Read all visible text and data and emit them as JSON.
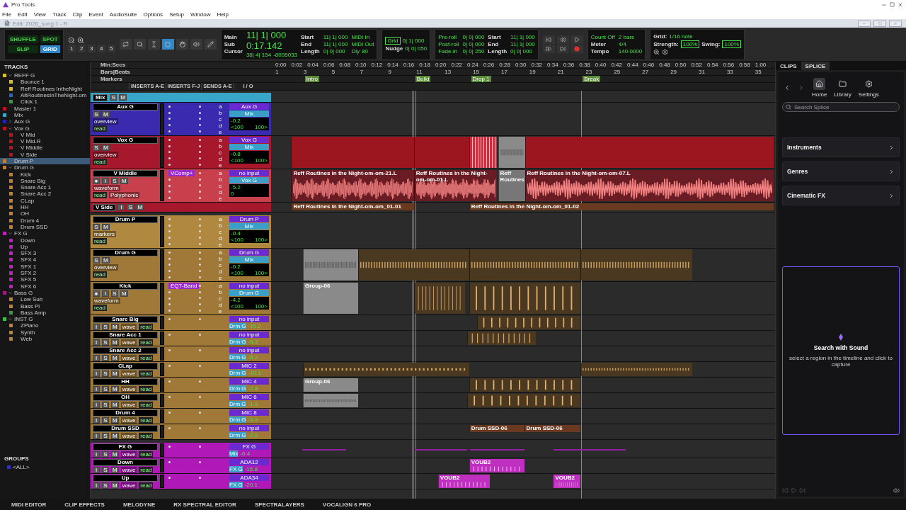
{
  "window": {
    "title": "Pro Tools"
  },
  "menu": [
    "File",
    "Edit",
    "View",
    "Track",
    "Clip",
    "Event",
    "AudioSuite",
    "Options",
    "Setup",
    "Window",
    "Help"
  ],
  "document": {
    "title": "Edit: 2026_song 1 - R"
  },
  "toolbar": {
    "edit_modes": [
      {
        "label": "SHUFFLE",
        "selected": false
      },
      {
        "label": "SPOT",
        "selected": false
      },
      {
        "label": "SLIP",
        "selected": false
      },
      {
        "label": "GRID",
        "selected": true
      }
    ],
    "zoom_presets": [
      "1",
      "2",
      "3",
      "4",
      "5"
    ],
    "counter": {
      "main_label": "Main",
      "main": "11| 1| 000",
      "sub_label": "Sub",
      "sub": "0:17.142",
      "cursor_label": "Cursor",
      "cursor": "38| 4| 154",
      "samples": "-8095033"
    },
    "selection": [
      {
        "label": "Start",
        "value": "11| 1| 000"
      },
      {
        "label": "End",
        "value": "11| 1| 000"
      },
      {
        "label": "Length",
        "value": "0| 0| 000"
      }
    ],
    "midi": [
      "MIDI In",
      "MIDI Out"
    ],
    "dly": "Dly",
    "velocity": "80",
    "grid": {
      "label": "Grid",
      "value": "0| 1| 000"
    },
    "nudge": {
      "label": "Nudge",
      "value": "0| 0| 050"
    },
    "preroll": [
      {
        "label": "Pre-roll",
        "value": "0| 0| 000"
      },
      {
        "label": "Post-roll",
        "value": "0| 0| 000"
      },
      {
        "label": "Fade-in",
        "value": "0| 0| 250"
      }
    ],
    "selection2": [
      {
        "label": "Start",
        "value": "11| 1| 000"
      },
      {
        "label": "End",
        "value": "11| 1| 000"
      },
      {
        "label": "Length",
        "value": "0| 0| 000"
      }
    ],
    "tempo": {
      "count_off": "Count Off",
      "count_value": "2 bars",
      "meter_label": "Meter",
      "meter": "4/4",
      "tempo_label": "Tempo",
      "tempo": "140.0000"
    },
    "quantize": {
      "grid_label": "Grid:",
      "grid": "1/16 note",
      "strength_label": "Strength:",
      "strength": "100%",
      "swing_label": "Swing:",
      "swing": "100%"
    }
  },
  "tracks_panel": {
    "title": "TRACKS",
    "items": [
      {
        "name": "REFF G",
        "color": "#d8c020",
        "expanded": true,
        "selected": false,
        "children": [
          {
            "name": "Bounce 1",
            "color": "#d8c020",
            "selected": false
          },
          {
            "name": "Reff Routines IntheNight",
            "color": "#d8c020",
            "selected": false
          },
          {
            "name": "AltRoutinesInTheNight.om",
            "color": "#3060d0",
            "selected": false
          },
          {
            "name": "Click 1",
            "color": "#30a040",
            "selected": false
          }
        ]
      },
      {
        "name": "Master 1",
        "color": "#c01020",
        "selected": false
      },
      {
        "name": "Mix",
        "color": "#37a6c8",
        "selected": false
      },
      {
        "name": "Aux G",
        "color": "#2020c0",
        "expanded": false,
        "selected": false
      },
      {
        "name": "Vox G",
        "color": "#c01020",
        "expanded": true,
        "selected": false,
        "children": [
          {
            "name": "V Mid",
            "color": "#c01020",
            "selected": false
          },
          {
            "name": "V Mid.R",
            "color": "#c01020",
            "selected": false
          },
          {
            "name": "V Middle",
            "color": "#c01020",
            "selected": false
          },
          {
            "name": "V Side",
            "color": "#c01020",
            "selected": false
          }
        ]
      },
      {
        "name": "Drum P",
        "color": "#c08030",
        "selected": true
      },
      {
        "name": "Drum G",
        "color": "#c08030",
        "expanded": true,
        "selected": false,
        "children": [
          {
            "name": "Kick",
            "color": "#c08030",
            "selected": false
          },
          {
            "name": "Snare Big",
            "color": "#c08030",
            "selected": false
          },
          {
            "name": "Snare Acc 1",
            "color": "#c08030",
            "selected": false
          },
          {
            "name": "Snare Acc 2",
            "color": "#c08030",
            "selected": false
          },
          {
            "name": "CLap",
            "color": "#c08030",
            "selected": false
          },
          {
            "name": "HH",
            "color": "#c08030",
            "selected": false
          },
          {
            "name": "OH",
            "color": "#c08030",
            "selected": false
          },
          {
            "name": "Drum 4",
            "color": "#c08030",
            "selected": false
          },
          {
            "name": "Drum SSD",
            "color": "#c08030",
            "selected": false
          }
        ]
      },
      {
        "name": "FX G",
        "color": "#c020c0",
        "expanded": true,
        "selected": false,
        "children": [
          {
            "name": "Down",
            "color": "#c020c0",
            "selected": false
          },
          {
            "name": "Up",
            "color": "#c020c0",
            "selected": false
          },
          {
            "name": "SFX 3",
            "color": "#c020c0",
            "selected": false
          },
          {
            "name": "SFX 4",
            "color": "#c020c0",
            "selected": false
          },
          {
            "name": "SFX 1",
            "color": "#c020c0",
            "selected": false
          },
          {
            "name": "SFX 2",
            "color": "#c020c0",
            "selected": false
          },
          {
            "name": "SFX 5",
            "color": "#c020c0",
            "selected": false
          },
          {
            "name": "SFX 6",
            "color": "#c020c0",
            "selected": false
          }
        ]
      },
      {
        "name": "Bass G",
        "color": "#a01880",
        "expanded": true,
        "selected": false,
        "children": [
          {
            "name": "Low Sub",
            "color": "#c08030",
            "selected": false
          },
          {
            "name": "Bass Pl",
            "color": "#c08030",
            "selected": false
          },
          {
            "name": "Bass Amp",
            "color": "#30a040",
            "selected": false
          }
        ]
      },
      {
        "name": "INST G",
        "color": "#40c040",
        "expanded": true,
        "selected": false,
        "children": [
          {
            "name": "ZPiano",
            "color": "#c08030",
            "selected": false
          },
          {
            "name": "Synth",
            "color": "#c08030",
            "selected": false
          },
          {
            "name": "Web",
            "color": "#c08030",
            "selected": false
          }
        ]
      }
    ]
  },
  "groups_panel": {
    "title": "GROUPS",
    "items": [
      {
        "name": "<ALL>",
        "color": "#3030c0"
      }
    ]
  },
  "rulers": [
    {
      "label": "Min:Secs",
      "ticks": [
        "0:00",
        "0:02",
        "0:04",
        "0:06",
        "0:08",
        "0:10",
        "0:12",
        "0:14",
        "0:16",
        "0:18",
        "0:20",
        "0:22",
        "0:24",
        "0:26",
        "0:28",
        "0:30",
        "0:32",
        "0:34",
        "0:36",
        "0:38",
        "0:40",
        "0:42",
        "0:44",
        "0:46",
        "0:48",
        "0:50",
        "0:52",
        "0:54",
        "0:56",
        "0:58",
        "1:00"
      ]
    },
    {
      "label": "Bars|Beats",
      "ticks": [
        "1",
        "3",
        "5",
        "7",
        "9",
        "11",
        "13",
        "15",
        "17",
        "19",
        "21",
        "23",
        "25",
        "27",
        "29",
        "31",
        "33",
        "35"
      ]
    },
    {
      "label": "Markers",
      "markers": [
        "Intro",
        "Build",
        "Drop 1",
        "Break"
      ]
    }
  ],
  "columns": [
    "INSERTS A-E",
    "INSERTS F-J",
    "SENDS A-E",
    "I / O"
  ],
  "tracks": [
    {
      "kind": "thin",
      "name": "Mix",
      "color": "#37a6c8",
      "buttons": [
        "S",
        "M"
      ]
    },
    {
      "kind": "large",
      "name": "Aux G",
      "color": "#3a2ab0",
      "buttons": [
        "S",
        "M"
      ],
      "view": "overview",
      "automation": "read",
      "sends": [
        "a",
        "b",
        "c",
        "d",
        "e"
      ],
      "input": "Aux G",
      "output": "Mix",
      "volume": "-0.2",
      "pan": [
        "<100",
        "100>"
      ]
    },
    {
      "kind": "large",
      "name": "Vox G",
      "color": "#a8182c",
      "buttons": [
        "S",
        "M"
      ],
      "view": "overview",
      "automation": "read",
      "sends": [
        "a",
        "b",
        "c",
        "d",
        "e"
      ],
      "input": "Vox G",
      "output": "Mix",
      "volume": "-0.8",
      "pan": [
        "<100",
        "100>"
      ],
      "clips": [
        {
          "kind": "block"
        },
        {
          "kind": "block"
        },
        {
          "kind": "striped"
        },
        {
          "kind": "grey"
        },
        {
          "kind": "block"
        }
      ]
    },
    {
      "kind": "large",
      "name": "V Middle",
      "color": "#c8404c",
      "buttons": [
        "●",
        "I",
        "S",
        "M"
      ],
      "view": "waveform",
      "automation": "read",
      "extra": "Polyphonic",
      "inserts": [
        "VComp+"
      ],
      "sends": [
        "a",
        "b",
        "c",
        "d",
        "e"
      ],
      "input": "no input",
      "output": "Vox G",
      "volume": "-5.2",
      "pan": [
        "0"
      ],
      "clips": [
        {
          "kind": "waveform",
          "label": "Reff Routines in the Night-om-om-21.L"
        },
        {
          "kind": "waveform",
          "label": "Reff Routines in the Night-om-om-01.L"
        },
        {
          "kind": "grey-wave",
          "label": "Reff Routines"
        },
        {
          "kind": "waveform",
          "label": "Reff Routines in the Night-om-om-07.L"
        }
      ]
    },
    {
      "kind": "thin",
      "name": "V Side",
      "color": "#a8182c",
      "buttons": [
        "I",
        "S",
        "M"
      ],
      "clips": [
        {
          "kind": "bar",
          "label": "Reff Routines in the Night-om-om_01-01"
        },
        {
          "kind": "bar",
          "label": "Reff Routines in the Night-om-om_01-02"
        }
      ]
    },
    {
      "kind": "large",
      "name": "Drum P",
      "color": "#b08840",
      "buttons": [
        "S",
        "M"
      ],
      "view": "markers",
      "automation": "read",
      "sends": [
        "a",
        "b",
        "c",
        "d",
        "e"
      ],
      "input": "Drum P",
      "output": "Mix",
      "volume": "-0.4",
      "pan": [
        "<100",
        "100>"
      ]
    },
    {
      "kind": "large",
      "name": "Drum G",
      "color": "#a07838",
      "buttons": [
        "S",
        "M"
      ],
      "view": "overview",
      "automation": "read",
      "sends": [
        "a",
        "b",
        "c",
        "d",
        "e"
      ],
      "input": "Drum G",
      "output": "Mix",
      "volume": "-0.2",
      "pan": [
        "<100",
        "100>"
      ],
      "clips": [
        {
          "kind": "grey"
        },
        {
          "kind": "strip"
        },
        {
          "kind": "strip"
        },
        {
          "kind": "strip"
        }
      ]
    },
    {
      "kind": "large",
      "name": "Kick",
      "color": "#a07838",
      "buttons": [
        "●",
        "I",
        "S",
        "M"
      ],
      "view": "waveform",
      "automation": "read",
      "inserts": [
        "EQ7-Band"
      ],
      "sends": [
        "a",
        "b",
        "c",
        "d",
        "e"
      ],
      "input": "no input",
      "output": "Drum G",
      "volume": "-4.2",
      "pan": [
        "<100",
        "100>"
      ],
      "clips": [
        {
          "kind": "grey",
          "label": "Group-06"
        },
        {
          "kind": "hits"
        },
        {
          "kind": "hits"
        }
      ]
    },
    {
      "kind": "small",
      "name": "Snare Big",
      "color": "#a07838",
      "buttons": [
        "I",
        "S",
        "M"
      ],
      "view": "wave",
      "automation": "read",
      "input": "no input",
      "output": "Drm G",
      "volume": "-15.2",
      "clips": [
        {
          "kind": "hits"
        }
      ]
    },
    {
      "kind": "small",
      "name": "Snare Acc 1",
      "color": "#a07838",
      "buttons": [
        "I",
        "S",
        "M"
      ],
      "view": "wave",
      "automation": "read",
      "input": "no input",
      "output": "Drm G",
      "volume": "-6.3",
      "clips": [
        {
          "kind": "hits"
        }
      ]
    },
    {
      "kind": "small",
      "name": "Snare Acc 2",
      "color": "#a07838",
      "buttons": [
        "I",
        "S",
        "M"
      ],
      "view": "wave",
      "automation": "read",
      "input": "no input",
      "output": "Drm G",
      "volume": "-6.2"
    },
    {
      "kind": "small",
      "name": "CLap",
      "color": "#a07838",
      "buttons": [
        "I",
        "S",
        "M"
      ],
      "view": "wave",
      "automation": "read",
      "input": "MIC 2",
      "output": "Drm G",
      "volume": "-10.1",
      "clips": [
        {
          "kind": "strip"
        },
        {
          "kind": "strip"
        }
      ]
    },
    {
      "kind": "small",
      "name": "HH",
      "color": "#a07838",
      "buttons": [
        "I",
        "S",
        "M"
      ],
      "view": "wave",
      "automation": "read",
      "input": "MIC 4",
      "output": "Drm G",
      "volume": "-2.8",
      "clips": [
        {
          "kind": "grey",
          "label": "Group-06"
        },
        {
          "kind": "hits"
        }
      ]
    },
    {
      "kind": "small",
      "name": "OH",
      "color": "#a07838",
      "buttons": [
        "I",
        "S",
        "M"
      ],
      "view": "wave",
      "automation": "read",
      "input": "MIC 6",
      "output": "Drm G",
      "volume": "-1.9",
      "clips": [
        {
          "kind": "grey"
        },
        {
          "kind": "hits"
        }
      ]
    },
    {
      "kind": "small",
      "name": "Drum 4",
      "color": "#a07838",
      "buttons": [
        "I",
        "S",
        "M"
      ],
      "view": "wave",
      "automation": "read",
      "input": "MIC 8",
      "output": "Drm G",
      "volume": "-5.9"
    },
    {
      "kind": "small",
      "name": "Drum SSD",
      "color": "#a07838",
      "buttons": [
        "I",
        "S",
        "M"
      ],
      "view": "wave",
      "automation": "read",
      "input": "no input",
      "output": "Drm G",
      "volume": "-2.0",
      "clips": [
        {
          "kind": "bar",
          "label": "Drum SSD-06"
        },
        {
          "kind": "bar",
          "label": "Drum SSD-06"
        }
      ]
    },
    {
      "kind": "small",
      "name": "FX G",
      "color": "#b018b8",
      "buttons": [
        "I",
        "S",
        "M"
      ],
      "view": "wave",
      "automation": "read",
      "input": "FX G",
      "output": "Mix",
      "volume": "-0.4",
      "clips": [
        {
          "kind": "line"
        },
        {
          "kind": "line"
        },
        {
          "kind": "line"
        },
        {
          "kind": "line"
        }
      ]
    },
    {
      "kind": "small",
      "name": "Down",
      "color": "#b018b8",
      "buttons": [
        "I",
        "S",
        "M"
      ],
      "view": "wave",
      "automation": "read",
      "input": "ADA12",
      "output": "FX G",
      "volume": "-15.8",
      "clips": [
        {
          "kind": "midi",
          "label": "VOUB2"
        }
      ]
    },
    {
      "kind": "small",
      "name": "Up",
      "color": "#b018b8",
      "buttons": [
        "I",
        "S",
        "M"
      ],
      "view": "wave",
      "automation": "read",
      "input": "ADA34",
      "output": "FX G",
      "volume": "-20.1",
      "clips": [
        {
          "kind": "midi",
          "label": "VOUB2"
        },
        {
          "kind": "midi",
          "label": "VOUB2"
        }
      ]
    }
  ],
  "side_panel": {
    "tabs": [
      {
        "label": "CLIPS",
        "selected": false
      },
      {
        "label": "SPLICE",
        "selected": true
      }
    ],
    "nav": [
      {
        "label": "Home",
        "selected": true
      },
      {
        "label": "Library",
        "selected": false
      },
      {
        "label": "Settings",
        "selected": false
      }
    ],
    "search": {
      "placeholder": "Search Splice"
    },
    "categories": [
      "Instruments",
      "Genres",
      "Cinematic FX"
    ],
    "capture": {
      "title": "Search with Sound",
      "text": "select a region in the timeline and click to capture"
    }
  },
  "bottom_tabs": [
    "MIDI EDITOR",
    "CLIP EFFECTS",
    "MELODYNE",
    "RX SPECTRAL EDITOR",
    "SPECTRALAYERS",
    "VOCALIGN 6 PRO"
  ]
}
